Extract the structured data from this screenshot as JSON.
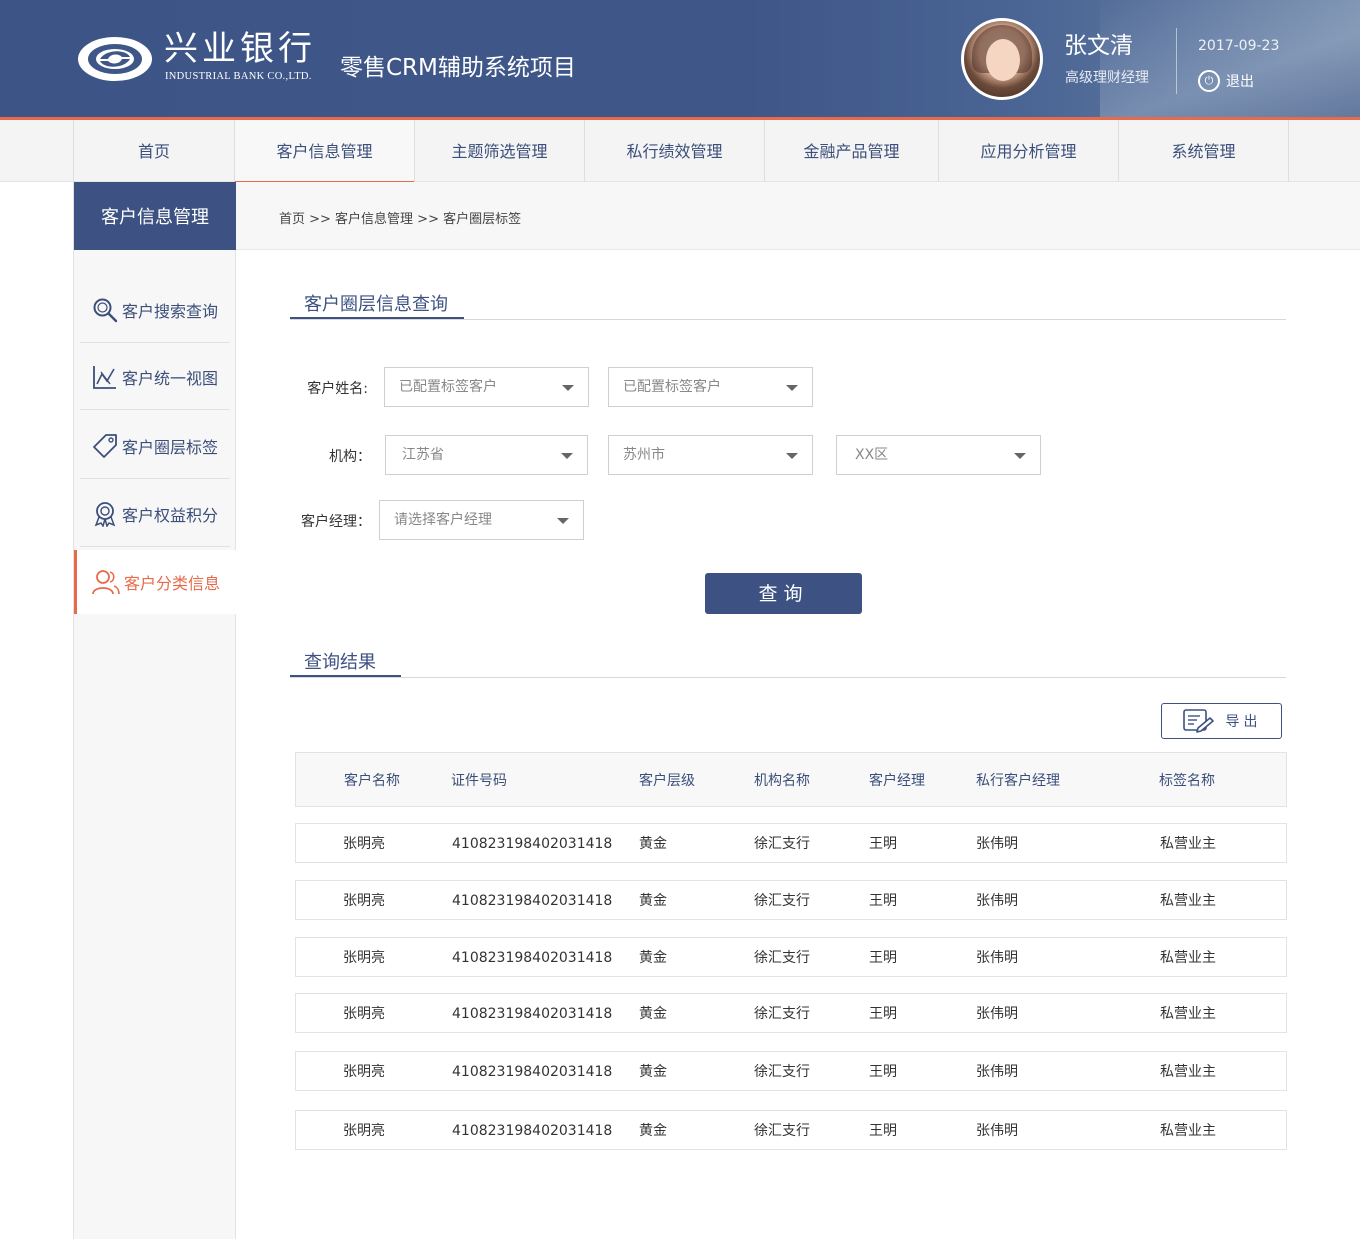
{
  "header": {
    "logo_text": "兴业银行",
    "logo_sub": "INDUSTRIAL BANK CO.,LTD.",
    "system_title": "零售CRM辅助系统项目",
    "user_name": "张文清",
    "user_role": "高级理财经理",
    "date": "2017-09-23",
    "logout_label": "退出",
    "logout_icon": "power-icon"
  },
  "nav": {
    "items": [
      {
        "label": "首页"
      },
      {
        "label": "客户信息管理"
      },
      {
        "label": "主题筛选管理"
      },
      {
        "label": "私行绩效管理"
      },
      {
        "label": "金融产品管理"
      },
      {
        "label": "应用分析管理"
      },
      {
        "label": "系统管理"
      }
    ],
    "active_index": 1
  },
  "sidebar": {
    "title": "客户信息管理",
    "items": [
      {
        "label": "客户搜索查询",
        "icon": "search-icon"
      },
      {
        "label": "客户统一视图",
        "icon": "chart-icon"
      },
      {
        "label": "客户圈层标签",
        "icon": "tag-icon"
      },
      {
        "label": "客户权益积分",
        "icon": "award-icon"
      },
      {
        "label": "客户分类信息",
        "icon": "users-icon"
      }
    ],
    "active_index": 4
  },
  "breadcrumb": "首页 >> 客户信息管理 >> 客户圈层标签",
  "query": {
    "section_title": "客户圈层信息查询",
    "name_label": "客户姓名:",
    "name_select_1": "已配置标签客户",
    "name_select_2": "已配置标签客户",
    "org_label": "机构：",
    "org_province": "江苏省",
    "org_city": "苏州市",
    "org_district": "XX区",
    "manager_label": "客户经理：",
    "manager_placeholder": "请选择客户经理",
    "button_label": "查询"
  },
  "results": {
    "section_title": "查询结果",
    "export_label": "导出",
    "export_icon": "export-icon",
    "columns": [
      "客户名称",
      "证件号码",
      "客户层级",
      "机构名称",
      "客户经理",
      "私行客户经理",
      "标签名称"
    ],
    "rows": [
      [
        "张明亮",
        "410823198402031418",
        "黄金",
        "徐汇支行",
        "王明",
        "张伟明",
        "私营业主"
      ],
      [
        "张明亮",
        "410823198402031418",
        "黄金",
        "徐汇支行",
        "王明",
        "张伟明",
        "私营业主"
      ],
      [
        "张明亮",
        "410823198402031418",
        "黄金",
        "徐汇支行",
        "王明",
        "张伟明",
        "私营业主"
      ],
      [
        "张明亮",
        "410823198402031418",
        "黄金",
        "徐汇支行",
        "王明",
        "张伟明",
        "私营业主"
      ],
      [
        "张明亮",
        "410823198402031418",
        "黄金",
        "徐汇支行",
        "王明",
        "张伟明",
        "私营业主"
      ],
      [
        "张明亮",
        "410823198402031418",
        "黄金",
        "徐汇支行",
        "王明",
        "张伟明",
        "私营业主"
      ]
    ]
  },
  "colors": {
    "primary": "#3d5282",
    "accent": "#e76b4a",
    "header_bg": "#3f5788"
  }
}
